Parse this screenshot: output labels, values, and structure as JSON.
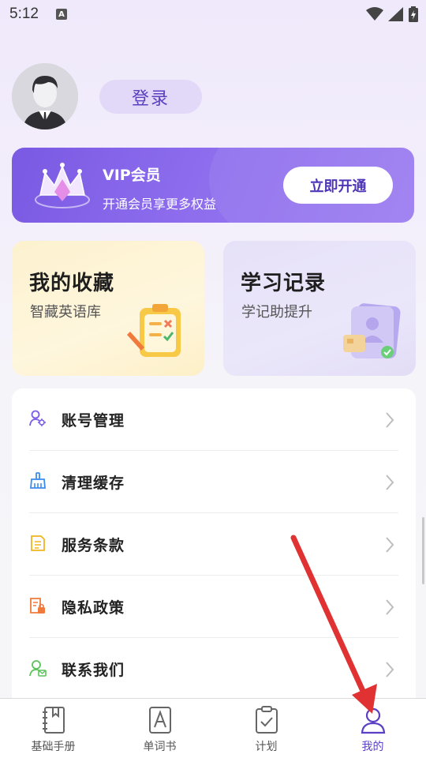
{
  "status_bar": {
    "time": "5:12",
    "notice_glyph": "A"
  },
  "profile": {
    "login_label": "登录"
  },
  "vip": {
    "title": "VIP会员",
    "subtitle": "开通会员享更多权益",
    "button_label": "立即开通",
    "accent": "#7a59e3"
  },
  "cards": {
    "favorites": {
      "title": "我的收藏",
      "subtitle": "智藏英语库"
    },
    "history": {
      "title": "学习记录",
      "subtitle": "学记助提升"
    }
  },
  "menu": {
    "items": [
      {
        "label": "账号管理",
        "icon": "account-icon",
        "color": "#7b5ce6"
      },
      {
        "label": "清理缓存",
        "icon": "broom-icon",
        "color": "#3b8cf0"
      },
      {
        "label": "服务条款",
        "icon": "document-icon",
        "color": "#f2b321"
      },
      {
        "label": "隐私政策",
        "icon": "privacy-icon",
        "color": "#f07a3b"
      },
      {
        "label": "联系我们",
        "icon": "contact-icon",
        "color": "#5cc35a"
      }
    ]
  },
  "tabbar": {
    "items": [
      {
        "label": "基础手册",
        "icon": "handbook-icon"
      },
      {
        "label": "单词书",
        "icon": "wordbook-icon"
      },
      {
        "label": "计划",
        "icon": "plan-icon"
      },
      {
        "label": "我的",
        "icon": "profile-icon",
        "active": true
      }
    ],
    "active_color": "#5b3fc4"
  }
}
